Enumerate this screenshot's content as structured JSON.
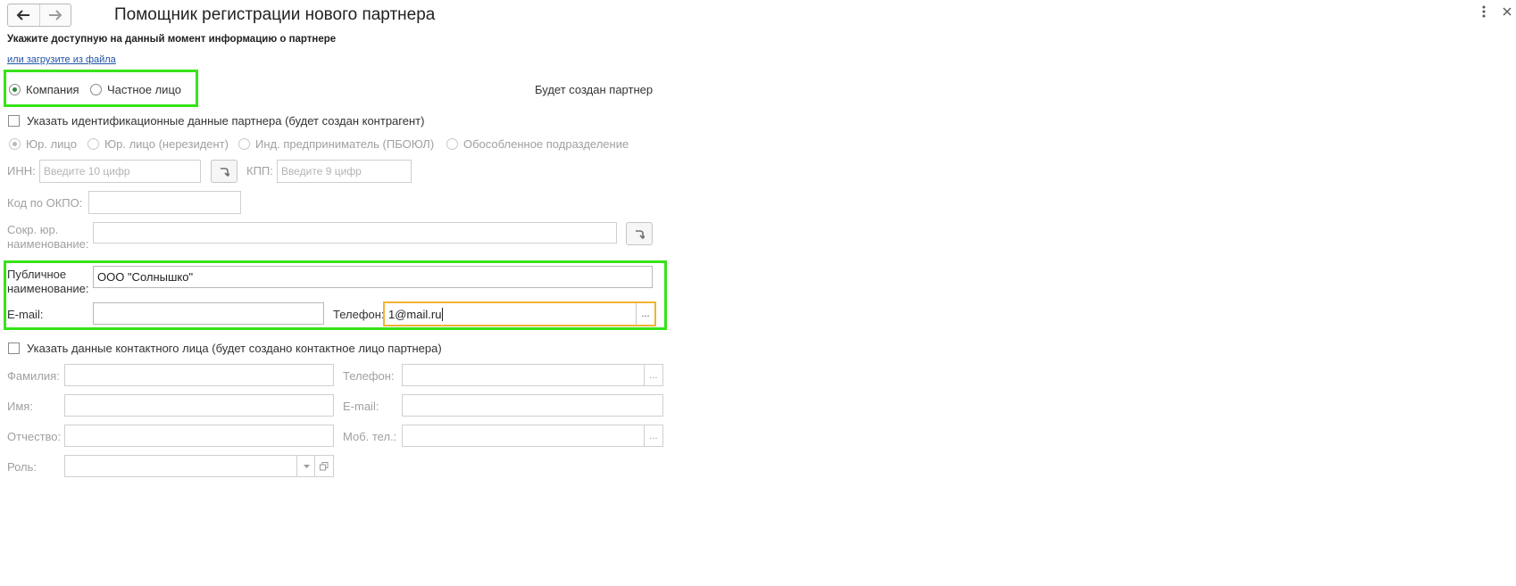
{
  "window": {
    "title": "Помощник регистрации нового партнера"
  },
  "header": {
    "hint": "Укажите доступную на данный момент информацию о партнере",
    "load_link": "или загрузите из файла",
    "partner_status": "Будет создан партнер"
  },
  "partner_type": {
    "options": [
      "Компания",
      "Частное лицо"
    ],
    "selected": "Компания"
  },
  "ident": {
    "checkbox_label": "Указать идентификационные данные партнера (будет создан контрагент)",
    "checked": false,
    "entity_types": [
      "Юр. лицо",
      "Юр. лицо (нерезидент)",
      "Инд. предприниматель (ПБОЮЛ)",
      "Обособленное подразделение"
    ],
    "entity_selected": "Юр. лицо",
    "inn_label": "ИНН:",
    "inn_placeholder": "Введите 10 цифр",
    "kpp_label": "КПП:",
    "kpp_placeholder": "Введите 9 цифр",
    "okpo_label": "Код по ОКПО:",
    "short_name_label_1": "Сокр. юр.",
    "short_name_label_2": "наименование:"
  },
  "public": {
    "name_label_1": "Публичное",
    "name_label_2": "наименование:",
    "name_value": "ООО \"Солнышко\"",
    "email_label": "E-mail:",
    "email_value": "",
    "phone_label": "Телефон:",
    "phone_value": "1@mail.ru"
  },
  "contact": {
    "checkbox_label": "Указать данные контактного лица (будет создано контактное лицо партнера)",
    "checked": false,
    "surname_label": "Фамилия:",
    "name_label": "Имя:",
    "patronymic_label": "Отчество:",
    "role_label": "Роль:",
    "phone_label": "Телефон:",
    "email_label": "E-mail:",
    "mobile_label": "Моб. тел.:"
  },
  "icons": {
    "back": "arrow-left-icon",
    "forward": "arrow-right-icon",
    "more": "kebab-menu-icon",
    "close": "close-icon",
    "fill": "fill-by-inn-icon",
    "open": "open-item-icon",
    "dropdown": "dropdown-arrow-icon"
  },
  "colors": {
    "highlight": "#37e319",
    "active_field": "#f2b233",
    "link": "#1f53a8",
    "radio_selected": "#2d8a3e"
  }
}
